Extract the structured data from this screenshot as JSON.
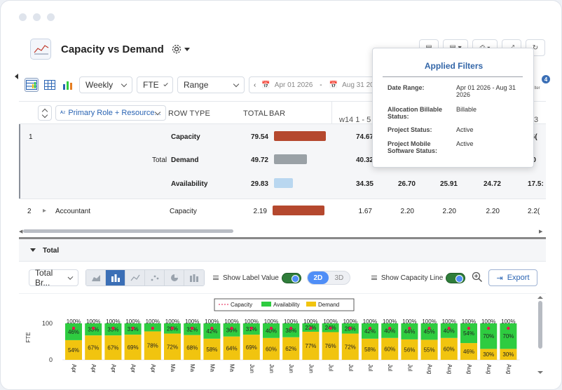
{
  "header": {
    "title": "Capacity vs Demand"
  },
  "toolbar": {
    "period": "Weekly",
    "unit": "FTE",
    "range": "Range",
    "date_from": "Apr 01 2026",
    "date_sep": "-",
    "date_to": "Aug 31 2026"
  },
  "grid": {
    "group_by": "Primary Role + Resource...",
    "col_row_type": "ROW TYPE",
    "col_total": "TOTAL",
    "col_bar": "BAR",
    "week_label": "w14 1 - 5",
    "week_partial": "3",
    "rows": [
      {
        "num": "1",
        "group": "Total",
        "type": "Capacity",
        "total": "79.54",
        "w1": "74.67",
        "w2": "",
        "w3": "",
        "w4": "",
        "w5": ".6(",
        "bar_pct": 1.0,
        "bar_color": "#b5482e"
      },
      {
        "num": "",
        "group": "",
        "type": "Demand",
        "total": "49.72",
        "w1": "40.32",
        "w2": "",
        "w3": "",
        "w4": "",
        "w5": "'0",
        "bar_pct": 0.63,
        "bar_color": "#9aa1a6"
      },
      {
        "num": "",
        "group": "",
        "type": "Availability",
        "total": "29.83",
        "w1": "34.35",
        "w2": "26.70",
        "w3": "25.91",
        "w4": "24.72",
        "w5": "17.5:",
        "bar_pct": 0.37,
        "bar_color": "#b9d7f0"
      },
      {
        "num": "2",
        "group": "Accountant",
        "type": "Capacity",
        "total": "2.19",
        "w1": "1.67",
        "w2": "2.20",
        "w3": "2.20",
        "w4": "2.20",
        "w5": "2.2(",
        "bar_pct": 1.0,
        "bar_color": "#b5482e"
      }
    ]
  },
  "section": {
    "label": "Total"
  },
  "chart_controls": {
    "metric": "Total Br...",
    "show_label_value": "Show Label Value",
    "mode_2d": "2D",
    "mode_3d": "3D",
    "show_capacity_line": "Show Capacity Line",
    "export": "Export"
  },
  "popup": {
    "title": "Applied Filters",
    "items": [
      {
        "key": "Date Range:",
        "value": "Apr 01 2026 - Aug 31 2026"
      },
      {
        "key": "Allocation Billable Status:",
        "value": "Billable"
      },
      {
        "key": "Project Status:",
        "value": "Active"
      },
      {
        "key": "Project Mobile Software Status:",
        "value": "Active"
      }
    ],
    "badge": "4",
    "filter_label": "ilter"
  },
  "colors": {
    "availability": "#2ecc40",
    "demand": "#f1c40f",
    "capacity": "#e6194b",
    "accent": "#3b6fb6"
  },
  "chart_data": {
    "type": "bar",
    "stacked": true,
    "ylabel": "FTE",
    "ylim": [
      0,
      100
    ],
    "yticks": [
      0,
      100
    ],
    "legend": [
      "Capacity",
      "Availability",
      "Demand"
    ],
    "legend_position": "top",
    "categories": [
      "Apr",
      "Apr",
      "Apr",
      "Apr",
      "Apr",
      "Ma",
      "Ma",
      "Ma",
      "Ma",
      "Jun",
      "Jun",
      "Jun",
      "Jun",
      "Jul",
      "Jul",
      "Jul",
      "Jul",
      "Jul",
      "Aug",
      "Aug",
      "Aug",
      "Aug",
      "Aug"
    ],
    "series": [
      {
        "name": "Demand",
        "values": [
          54,
          67,
          67,
          69,
          78,
          72,
          68,
          58,
          64,
          69,
          60,
          62,
          77,
          76,
          72,
          58,
          60,
          56,
          55,
          60,
          46,
          30,
          30
        ]
      },
      {
        "name": "Availability",
        "values": [
          46,
          33,
          33,
          31,
          22,
          28,
          32,
          42,
          36,
          31,
          40,
          38,
          23,
          24,
          28,
          42,
          40,
          44,
          45,
          40,
          54,
          70,
          70
        ]
      },
      {
        "name": "Capacity",
        "values": [
          100,
          100,
          100,
          100,
          100,
          100,
          100,
          100,
          100,
          100,
          100,
          100,
          100,
          100,
          100,
          100,
          100,
          100,
          100,
          100,
          100,
          100,
          100
        ]
      }
    ],
    "demand_labels": [
      "54%",
      "67%",
      "67%",
      "69%",
      "78%",
      "72%",
      "68%",
      "58%",
      "64%",
      "69%",
      "60%",
      "62%",
      "77%",
      "76%",
      "72%",
      "58%",
      "60%",
      "56%",
      "55%",
      "60%",
      "46%",
      "30%",
      "30%"
    ],
    "availability_labels": [
      "46%",
      "33%",
      "33%",
      "31%",
      "",
      "28%",
      "32%",
      "42%",
      "36%",
      "31%",
      "40%",
      "38%",
      "23%",
      "24%",
      "28%",
      "42%",
      "40%",
      "44%",
      "45%",
      "40%",
      "54%",
      "70%",
      "70%"
    ],
    "capacity_labels": [
      "100%",
      "100%",
      "100%",
      "100%",
      "100%",
      "100%",
      "100%",
      "100%",
      "100%",
      "100%",
      "100%",
      "100%",
      "100%",
      "100%",
      "100%",
      "100%",
      "100%",
      "100%",
      "100%",
      "100%",
      "100%",
      "100%",
      "100%"
    ]
  }
}
